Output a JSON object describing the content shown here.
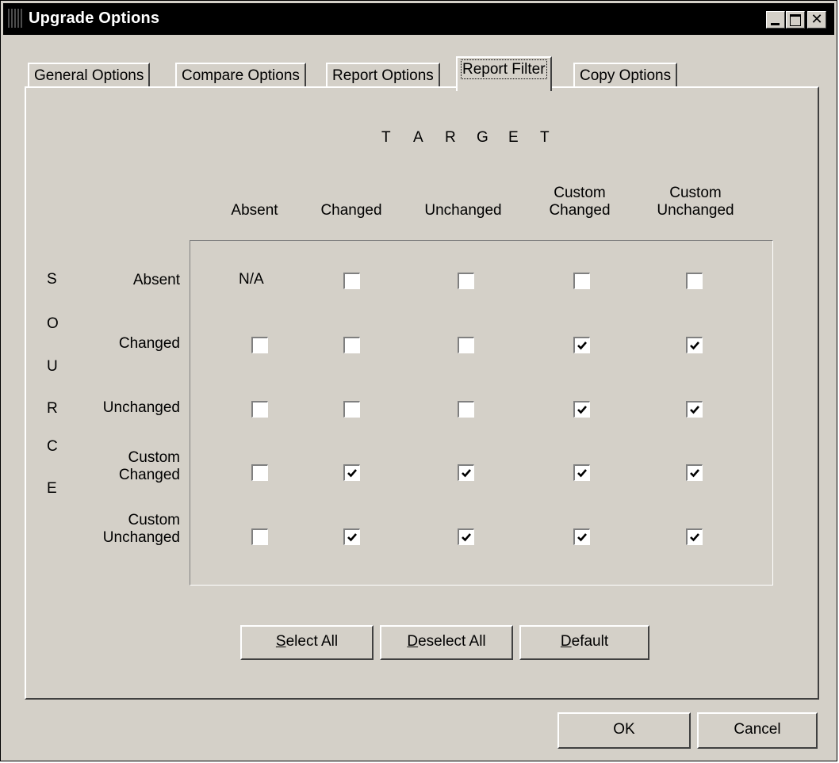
{
  "window": {
    "title": "Upgrade Options"
  },
  "tabs": [
    {
      "label": "General Options",
      "active": false
    },
    {
      "label": "Compare Options",
      "active": false
    },
    {
      "label": "Report Options",
      "active": false
    },
    {
      "label": "Report Filter",
      "active": true
    },
    {
      "label": "Copy Options",
      "active": false
    }
  ],
  "target_heading": [
    "T",
    "A",
    "R",
    "G",
    "E",
    "T"
  ],
  "source_heading": [
    "S",
    "O",
    "U",
    "R",
    "C",
    "E"
  ],
  "columns": [
    {
      "line1": "",
      "line2": "Absent"
    },
    {
      "line1": "",
      "line2": "Changed"
    },
    {
      "line1": "",
      "line2": "Unchanged"
    },
    {
      "line1": "Custom",
      "line2": "Changed"
    },
    {
      "line1": "Custom",
      "line2": "Unchanged"
    }
  ],
  "rows": [
    {
      "line1": "",
      "line2": "Absent",
      "cells": [
        "N/A",
        false,
        false,
        false,
        false
      ]
    },
    {
      "line1": "",
      "line2": "Changed",
      "cells": [
        false,
        false,
        false,
        true,
        true
      ]
    },
    {
      "line1": "",
      "line2": "Unchanged",
      "cells": [
        false,
        false,
        false,
        true,
        true
      ]
    },
    {
      "line1": "Custom",
      "line2": "Changed",
      "cells": [
        false,
        true,
        true,
        true,
        true
      ]
    },
    {
      "line1": "Custom",
      "line2": "Unchanged",
      "cells": [
        false,
        true,
        true,
        true,
        true
      ]
    }
  ],
  "buttons": {
    "select_all": {
      "mnemonic": "S",
      "rest": "elect All"
    },
    "deselect_all": {
      "mnemonic": "D",
      "rest": "eselect All"
    },
    "default": {
      "mnemonic": "D",
      "rest": "efault"
    },
    "ok": "OK",
    "cancel": "Cancel"
  }
}
